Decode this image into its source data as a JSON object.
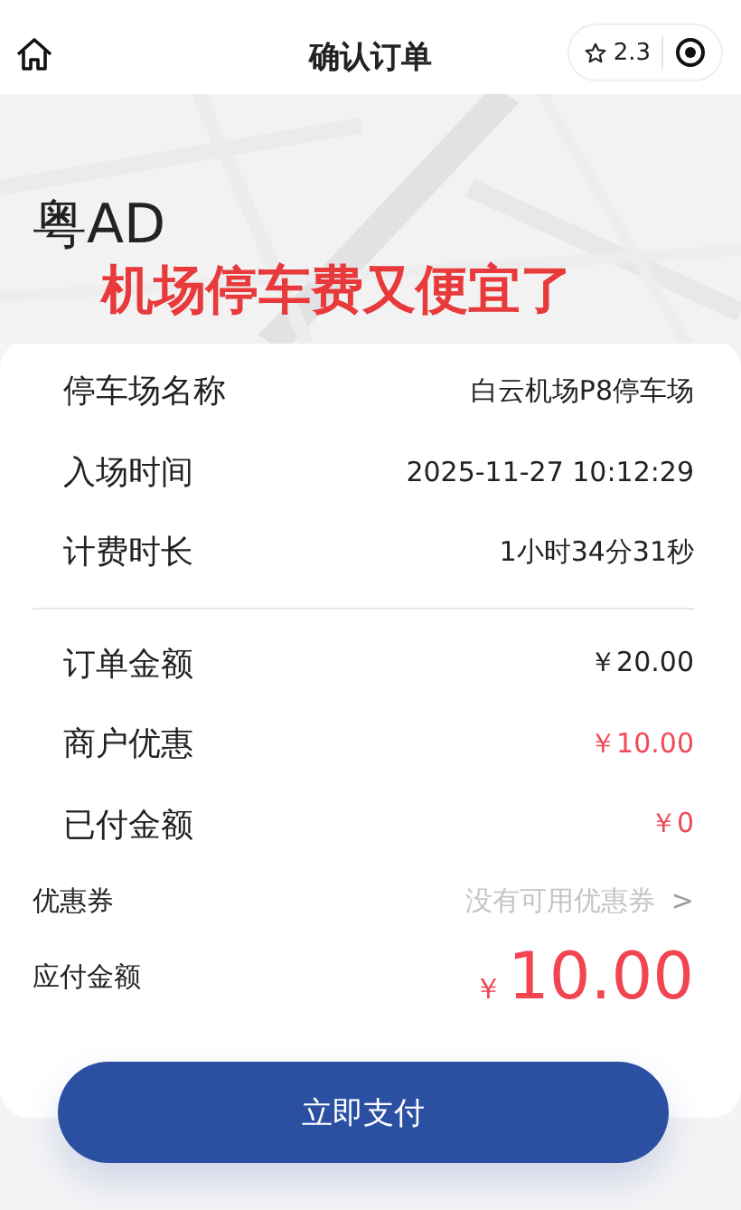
{
  "header": {
    "title": "确认订单",
    "rating": "2.3"
  },
  "banner": {
    "plate": "粤AD",
    "caption": "机场停车费又便宜了"
  },
  "details": [
    {
      "label": "停车场名称",
      "value": "白云机场P8停车场",
      "accent": false
    },
    {
      "label": "入场时间",
      "value": "2025-11-27 10:12:29",
      "accent": false
    },
    {
      "label": "计费时长",
      "value": "1小时34分31秒",
      "accent": false
    }
  ],
  "amounts": [
    {
      "label": "订单金额",
      "value": "￥20.00",
      "accent": false
    },
    {
      "label": "商户优惠",
      "value": "￥10.00",
      "accent": true
    },
    {
      "label": "已付金额",
      "value": "￥0",
      "accent": true
    }
  ],
  "coupon": {
    "label": "优惠券",
    "value": "没有可用优惠券",
    "chevron": ">"
  },
  "payable": {
    "label": "应付金额",
    "currency": "￥",
    "amount": "10.00"
  },
  "pay_button": "立即支付"
}
